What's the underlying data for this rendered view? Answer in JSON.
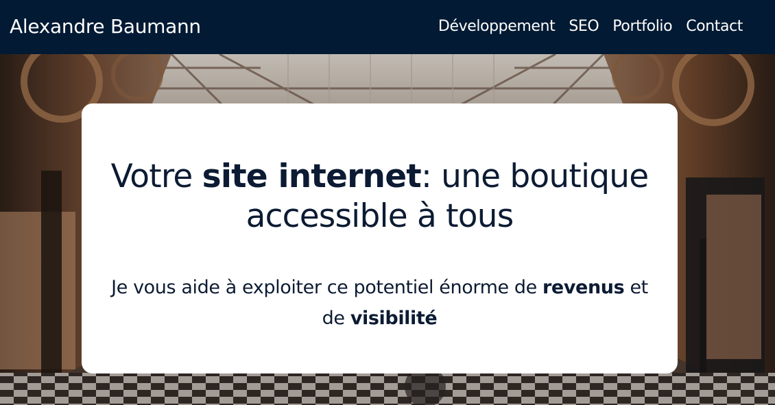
{
  "header": {
    "brand": "Alexandre Baumann",
    "nav": [
      {
        "label": "Développement"
      },
      {
        "label": "SEO"
      },
      {
        "label": "Portfolio"
      },
      {
        "label": "Contact"
      }
    ],
    "background_color": "#021a33"
  },
  "hero": {
    "background_image": "shopping-arcade-photo",
    "headline": {
      "part1": "Votre ",
      "bold": "site internet",
      "part2": ": une boutique accessible à tous"
    },
    "subline": {
      "part1": "Je vous aide à exploiter ce potentiel énorme de ",
      "bold1": "revenus",
      "part2": " et de ",
      "bold2": "visibilité"
    },
    "text_color": "#0c1b33"
  }
}
